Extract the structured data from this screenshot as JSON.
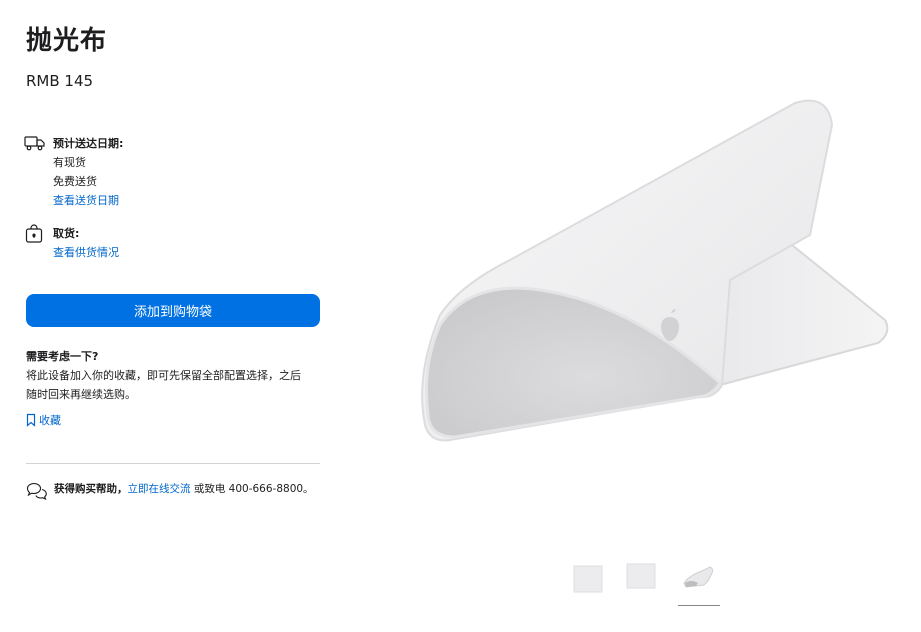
{
  "product": {
    "title": "抛光布",
    "price": "RMB 145"
  },
  "delivery": {
    "heading": "预计送达日期:",
    "availability": "有现货",
    "shipping": "免费送货",
    "check_link": "查看送货日期"
  },
  "pickup": {
    "heading": "取货:",
    "check_link": "查看供货情况"
  },
  "add_to_bag": "添加到购物袋",
  "consider": {
    "heading": "需要考虑一下?",
    "line1": "将此设备加入你的收藏，即可先保留全部配置选择，之后",
    "line2": "随时回来再继续选购。",
    "save_label": "收藏"
  },
  "help": {
    "bold": "获得购买帮助，",
    "chat_link": "立即在线交流",
    "tail": " 或致电 400-666-8800。"
  },
  "gallery": {
    "selected_index": 3,
    "count": 3
  },
  "colors": {
    "accent": "#0071e3",
    "link": "#0066cc",
    "text": "#1d1d1f",
    "divider": "#d2d2d7"
  }
}
